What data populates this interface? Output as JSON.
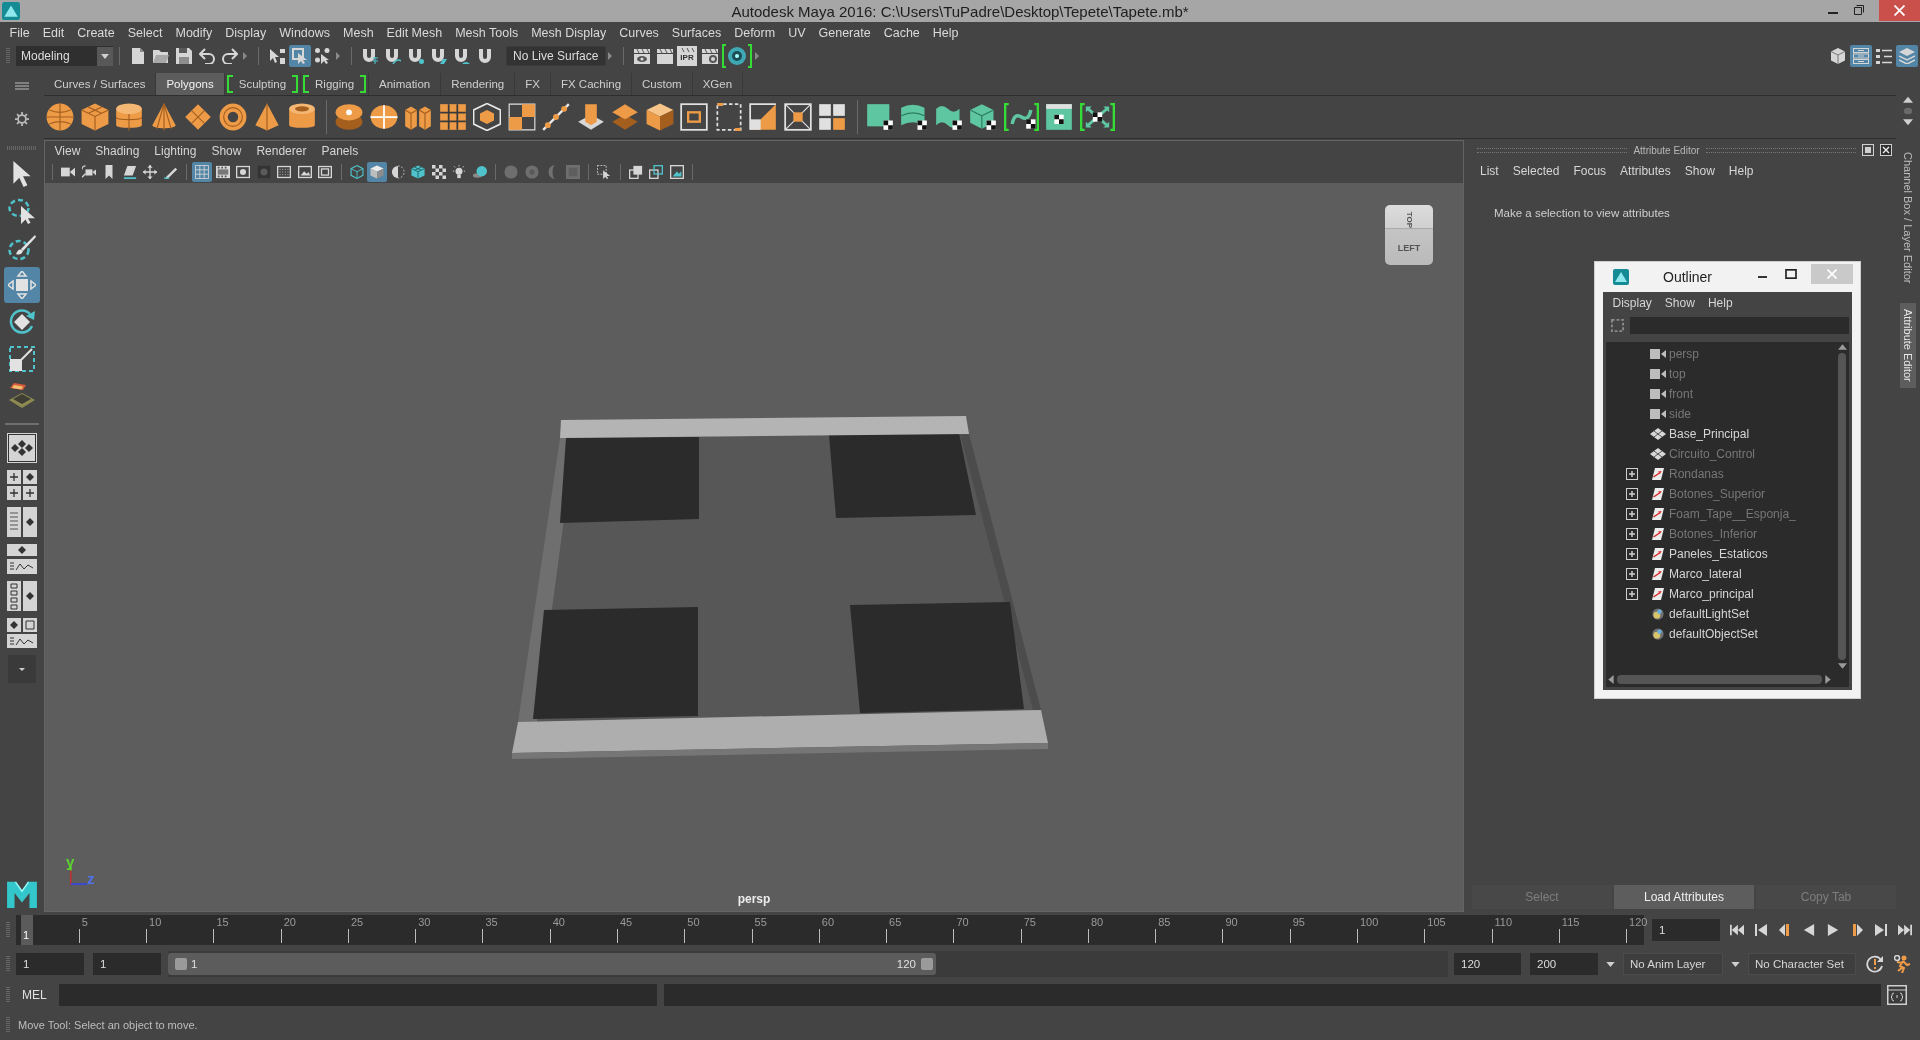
{
  "window": {
    "title": "Autodesk Maya 2016: C:\\Users\\TuPadre\\Desktop\\Tepete\\Tapete.mb*"
  },
  "menu_bar": [
    "File",
    "Edit",
    "Create",
    "Select",
    "Modify",
    "Display",
    "Windows",
    "Mesh",
    "Edit Mesh",
    "Mesh Tools",
    "Mesh Display",
    "Curves",
    "Surfaces",
    "Deform",
    "UV",
    "Generate",
    "Cache",
    "Help"
  ],
  "status_line": {
    "menu_set": "Modeling",
    "selection_modes": [
      {
        "selected": false
      },
      {
        "selected": true
      },
      {
        "selected": false
      }
    ],
    "live_surface": "No Live Surface",
    "ipr_label": "IPR",
    "panel_toggles": [
      {
        "on": false
      },
      {
        "on": true
      },
      {
        "on": false
      },
      {
        "on": true
      }
    ]
  },
  "shelf": {
    "tabs": [
      {
        "label": "Curves / Surfaces",
        "selected": false,
        "bracketed": false
      },
      {
        "label": "Polygons",
        "selected": true,
        "bracketed": false
      },
      {
        "label": "Sculpting",
        "selected": false,
        "bracketed": true
      },
      {
        "label": "Rigging",
        "selected": false,
        "bracketed": true
      },
      {
        "label": "Animation",
        "selected": false,
        "bracketed": false
      },
      {
        "label": "Rendering",
        "selected": false,
        "bracketed": false
      },
      {
        "label": "FX",
        "selected": false,
        "bracketed": false
      },
      {
        "label": "FX Caching",
        "selected": false,
        "bracketed": false
      },
      {
        "label": "Custom",
        "selected": false,
        "bracketed": false
      },
      {
        "label": "XGen",
        "selected": false,
        "bracketed": false
      }
    ]
  },
  "toolbox": {
    "tools": [
      {
        "selected": false
      },
      {
        "selected": false
      },
      {
        "selected": false
      },
      {
        "selected": true
      },
      {
        "selected": false
      },
      {
        "selected": false
      },
      {
        "selected": false
      }
    ]
  },
  "viewport": {
    "menus": [
      "View",
      "Shading",
      "Lighting",
      "Show",
      "Renderer",
      "Panels"
    ],
    "toolbar": [
      {
        "on": false,
        "disabled": false
      },
      {
        "on": false,
        "disabled": false
      },
      {
        "on": false,
        "disabled": false
      },
      {
        "on": false,
        "disabled": false
      },
      {
        "on": false,
        "disabled": false
      },
      {
        "on": false,
        "disabled": false
      },
      {
        "on": true,
        "disabled": false
      },
      {
        "on": false,
        "disabled": false
      },
      {
        "on": false,
        "disabled": false
      },
      {
        "on": false,
        "disabled": false
      },
      {
        "on": false,
        "disabled": false
      },
      {
        "on": false,
        "disabled": false
      },
      {
        "on": false,
        "disabled": false
      },
      {
        "on": false,
        "disabled": false
      },
      {
        "on": true,
        "disabled": false
      },
      {
        "on": false,
        "disabled": false
      },
      {
        "on": false,
        "disabled": false
      },
      {
        "on": false,
        "disabled": false
      },
      {
        "on": false,
        "disabled": false
      },
      {
        "on": false,
        "disabled": false
      },
      {
        "on": false,
        "disabled": true
      },
      {
        "on": false,
        "disabled": true
      },
      {
        "on": false,
        "disabled": true
      },
      {
        "on": false,
        "disabled": true
      },
      {
        "on": false,
        "disabled": false
      },
      {
        "on": false,
        "disabled": false
      },
      {
        "on": false,
        "disabled": false
      },
      {
        "on": false,
        "disabled": false
      }
    ],
    "view_cube": {
      "top_face": "TOP",
      "front_face": "LEFT"
    },
    "axes": [
      {
        "label": "y",
        "color": "#5cd62e"
      },
      {
        "label": "z",
        "color": "#4f72ee"
      }
    ],
    "camera": "persp"
  },
  "attribute_editor": {
    "title": "Attribute Editor",
    "menus": [
      "List",
      "Selected",
      "Focus",
      "Attributes",
      "Show",
      "Help"
    ],
    "message": "Make a selection to view attributes",
    "buttons": [
      {
        "label": "Select",
        "disabled": true
      },
      {
        "label": "Load Attributes",
        "disabled": false
      },
      {
        "label": "Copy Tab",
        "disabled": true
      }
    ]
  },
  "side_tabs": [
    {
      "label": "Channel Box / Layer Editor",
      "selected": false
    },
    {
      "label": "Attribute Editor",
      "selected": true
    }
  ],
  "outliner": {
    "title": "Outliner",
    "menus": [
      "Display",
      "Show",
      "Help"
    ],
    "items": [
      {
        "name": "persp",
        "kind": "camera",
        "hidden": true
      },
      {
        "name": "top",
        "kind": "camera",
        "hidden": true
      },
      {
        "name": "front",
        "kind": "camera",
        "hidden": true
      },
      {
        "name": "side",
        "kind": "camera",
        "hidden": true
      },
      {
        "name": "Base_Principal",
        "kind": "mesh",
        "hidden": false
      },
      {
        "name": "Circuito_Control",
        "kind": "mesh",
        "hidden": true
      },
      {
        "name": "Rondanas",
        "kind": "group",
        "hidden": true
      },
      {
        "name": "Botones_Superior",
        "kind": "group",
        "hidden": true
      },
      {
        "name": "Foam_Tape__Esponja_",
        "kind": "group",
        "hidden": true
      },
      {
        "name": "Botones_Inferior",
        "kind": "group",
        "hidden": true
      },
      {
        "name": "Paneles_Estaticos",
        "kind": "group",
        "hidden": false
      },
      {
        "name": "Marco_lateral",
        "kind": "group",
        "hidden": false
      },
      {
        "name": "Marco_principal",
        "kind": "group",
        "hidden": false
      },
      {
        "name": "defaultLightSet",
        "kind": "set",
        "hidden": false
      },
      {
        "name": "defaultObjectSet",
        "kind": "set",
        "hidden": false
      }
    ]
  },
  "timeline": {
    "ticks": [
      "5",
      "10",
      "15",
      "20",
      "25",
      "30",
      "35",
      "40",
      "45",
      "50",
      "55",
      "60",
      "65",
      "70",
      "75",
      "80",
      "85",
      "90",
      "95",
      "100",
      "105",
      "110",
      "115",
      "120"
    ],
    "current_frame": "1",
    "frame_field": "1"
  },
  "range_slider": {
    "start": "1",
    "playback_start": "1",
    "level": 0.6,
    "slider_start": "1",
    "slider_end": "120",
    "playback_end": "120",
    "end": "200",
    "anim_layer": "No Anim Layer",
    "character_set": "No Character Set"
  },
  "command_line": {
    "language": "MEL"
  },
  "help_line": "Move Tool: Select an object to move."
}
